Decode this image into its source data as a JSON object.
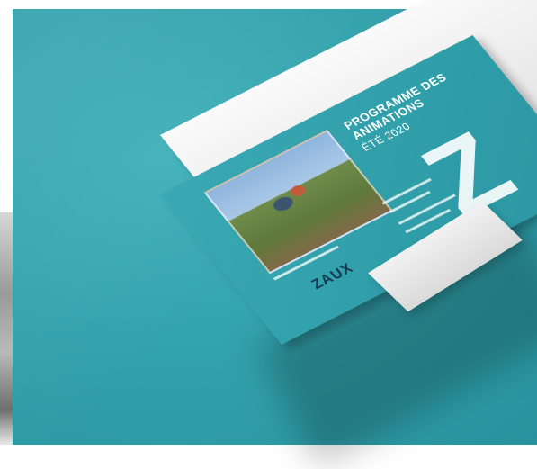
{
  "brochure": {
    "title_lines": [
      "PROGRAMME DES",
      "ANIMATIONS"
    ],
    "subtitle": "ÉTÉ 2020",
    "logo_text": "ZAUX"
  }
}
